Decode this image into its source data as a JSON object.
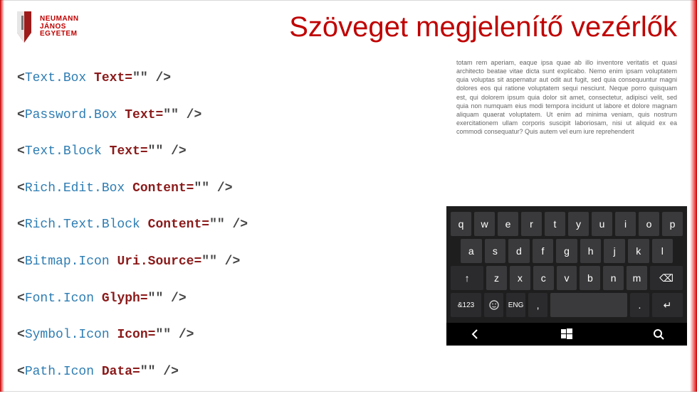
{
  "brand": {
    "name1": "NEUMANN",
    "name2": "JÁNOS",
    "name3": "EGYETEM"
  },
  "title": "Szöveget megjelenítő vezérlők",
  "code_lines": [
    {
      "tag": "Text.Box",
      "attr": "Text",
      "value": "\"\""
    },
    {
      "tag": "Password.Box",
      "attr": "Text",
      "value": "\"\""
    },
    {
      "tag": "Text.Block",
      "attr": "Text",
      "value": "\"\""
    },
    {
      "tag": "Rich.Edit.Box",
      "attr": "Content",
      "value": "\"\""
    },
    {
      "tag": "Rich.Text.Block",
      "attr": "Content",
      "value": "\"\""
    },
    {
      "tag": "Bitmap.Icon",
      "attr": "Uri.Source",
      "value": "\"\""
    },
    {
      "tag": "Font.Icon",
      "attr": "Glyph",
      "value": "\"\""
    },
    {
      "tag": "Symbol.Icon",
      "attr": "Icon",
      "value": "\"\""
    },
    {
      "tag": "Path.Icon",
      "attr": "Data",
      "value": "\"\""
    }
  ],
  "lorem": "totam rem aperiam, eaque ipsa quae ab illo inventore veritatis et quasi architecto beatae vitae dicta sunt explicabo. Nemo enim ipsam voluptatem quia voluptas sit aspernatur aut odit aut fugit, sed quia consequuntur magni dolores eos qui ratione voluptatem sequi nesciunt. Neque porro quisquam est, qui dolorem ipsum quia dolor sit amet, consectetur, adipisci velit, sed quia non numquam eius modi tempora incidunt ut labore et dolore magnam aliquam quaerat voluptatem. Ut enim ad minima veniam, quis nostrum exercitationem ullam corporis suscipit laboriosam, nisi ut aliquid ex ea commodi consequatur? Quis autem vel eum iure reprehenderit",
  "keyboard": {
    "row1": [
      "q",
      "w",
      "e",
      "r",
      "t",
      "y",
      "u",
      "i",
      "o",
      "p"
    ],
    "row2": [
      "a",
      "s",
      "d",
      "f",
      "g",
      "h",
      "j",
      "k",
      "l"
    ],
    "row3_shift": "↑",
    "row3": [
      "z",
      "x",
      "c",
      "v",
      "b",
      "n",
      "m"
    ],
    "row3_backspace": "⌫",
    "row4": {
      "sym": "&123",
      "lang": "ENG",
      "comma": ",",
      "space": "",
      "period": ".",
      "enter": "↵",
      "smile": "☺"
    }
  }
}
